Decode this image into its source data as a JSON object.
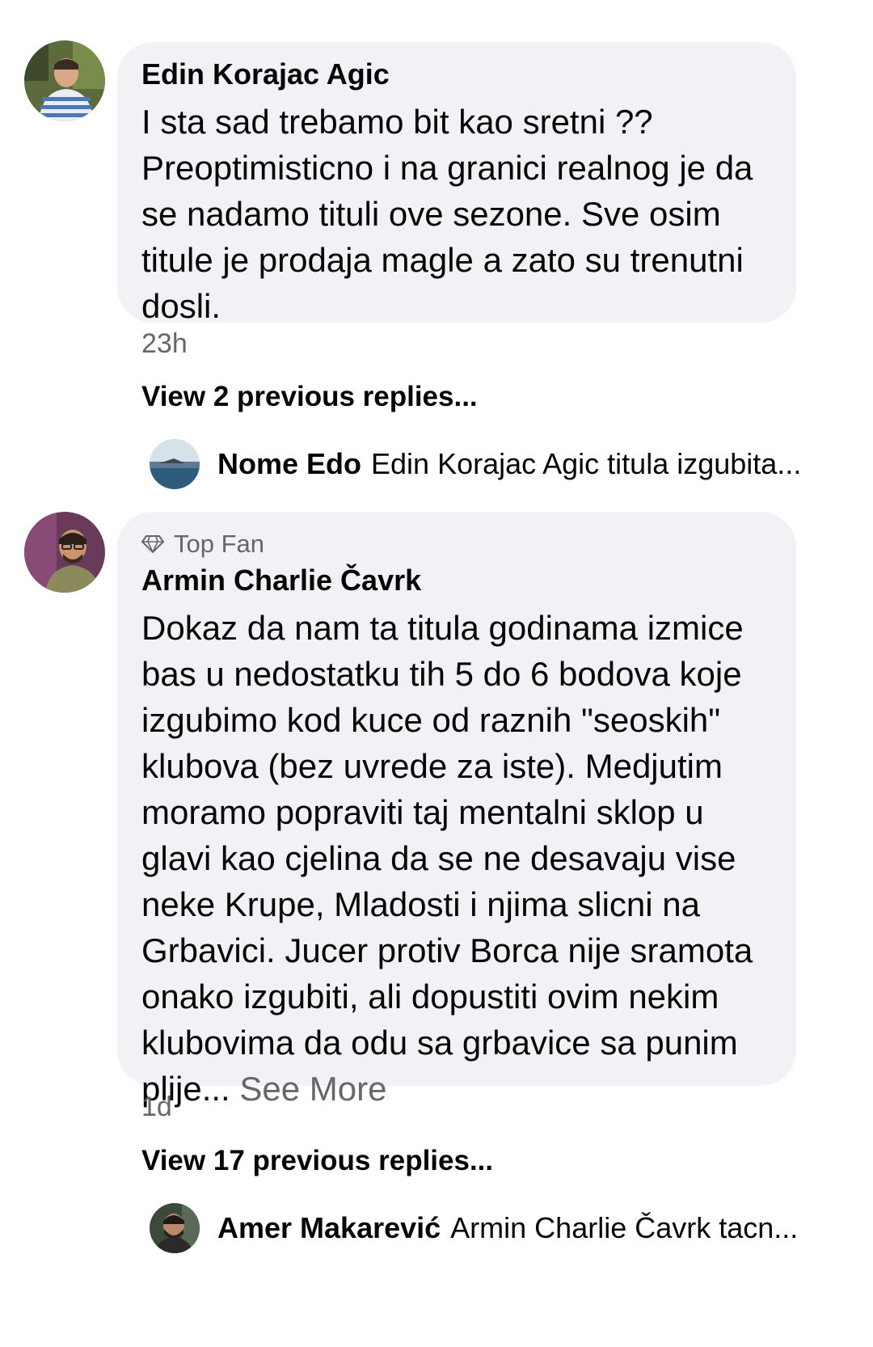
{
  "comments": [
    {
      "author": "Edin Korajac Agic",
      "text": "I sta sad trebamo bit kao sretni ?? Preoptimisticno i na granici realnog je da se nadamo tituli ove sezone. Sve osim titule je prodaja magle a zato su trenutni dosli.",
      "time": "23h",
      "view_replies": "View 2 previous replies...",
      "reply": {
        "author": "Nome Edo",
        "text": "Edin Korajac Agic titula izgubita..."
      }
    },
    {
      "badge": "Top Fan",
      "badge_icon": "diamond-icon",
      "author": "Armin Charlie Čavrk",
      "text": "Dokaz da nam ta titula godinama izmice bas u nedostatku tih 5 do 6 bodova koje izgubimo kod kuce od raznih \"seoskih\" klubova (bez uvrede za iste). Medjutim moramo popraviti taj mentalni sklop u glavi kao cjelina da se ne desavaju vise neke Krupe, Mladosti i njima slicni na Grbavici. Jucer protiv Borca nije sramota onako izgubiti, ali dopustiti ovim nekim klubovima da odu sa grbavice sa punim plije...",
      "see_more": "See More",
      "time": "1d",
      "view_replies": "View 17 previous replies...",
      "reply": {
        "author": "Amer Makarević",
        "text": "Armin Charlie Čavrk tacn..."
      }
    }
  ],
  "colors": {
    "bubble": "#f0f2f5",
    "text": "#050505",
    "secondary": "#65676b"
  }
}
